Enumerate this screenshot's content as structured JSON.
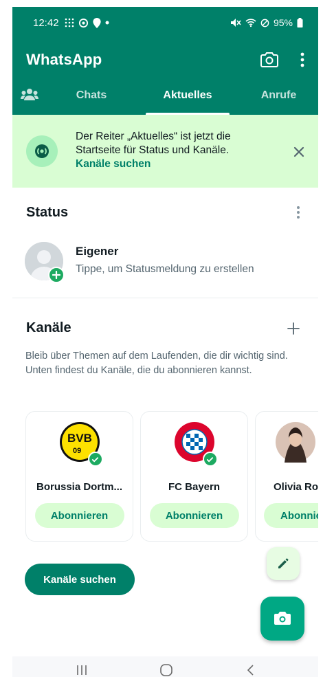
{
  "status_bar": {
    "time": "12:42",
    "battery": "95%"
  },
  "app": {
    "title": "WhatsApp"
  },
  "tabs": [
    {
      "label": "Chats"
    },
    {
      "label": "Aktuelles"
    },
    {
      "label": "Anrufe"
    }
  ],
  "banner": {
    "text": "Der Reiter „Aktuelles“ ist jetzt die Startseite für Status und Kanäle.",
    "link": "Kanäle suchen"
  },
  "status_section": {
    "title": "Status",
    "my_status_name": "Eigener",
    "my_status_hint": "Tippe, um Statusmeldung zu erstellen"
  },
  "channels_section": {
    "title": "Kanäle",
    "description": "Bleib über Themen auf dem Laufenden, die dir wichtig sind. Unten findest du Kanäle, die du abonnieren kannst.",
    "cards": [
      {
        "name": "Borussia Dortm...",
        "button": "Abonnieren"
      },
      {
        "name": "FC Bayern",
        "button": "Abonnieren"
      },
      {
        "name": "Olivia Ro",
        "button": "Abonnie"
      }
    ],
    "find_button": "Kanäle suchen"
  },
  "colors": {
    "primary": "#008069",
    "banner_bg": "#d9fdd3",
    "verified": "#1daa61",
    "fab": "#00a884"
  },
  "icons": {
    "community": "community-icon",
    "camera": "camera-icon",
    "menu": "more-vert-icon",
    "channel": "channel-icon",
    "close": "close-icon",
    "add": "plus-icon",
    "edit": "pencil-icon",
    "verified": "check-icon"
  }
}
